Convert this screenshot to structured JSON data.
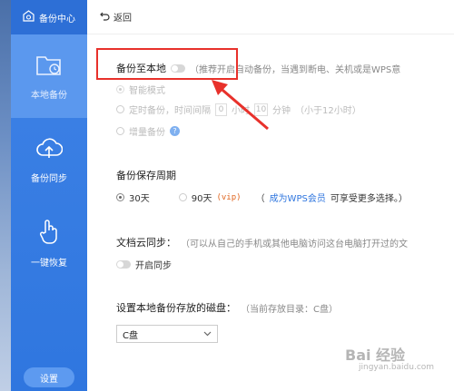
{
  "sidebar": {
    "header_label": "备份中心",
    "items": [
      {
        "label": "本地备份"
      },
      {
        "label": "备份同步"
      },
      {
        "label": "一键恢复"
      }
    ],
    "settings_label": "设置"
  },
  "topbar": {
    "back_label": "返回"
  },
  "local_backup": {
    "title": "备份至本地",
    "hint": "（推荐开启自动备份，当遇到断电、关机或是WPS意",
    "options": {
      "smart": "智能模式",
      "timed_prefix": "定时备份，时间间隔",
      "timed_hours_value": "0",
      "timed_hours_unit": "小时",
      "timed_minutes_value": "10",
      "timed_minutes_unit": "分钟",
      "timed_note": "（小于12小时）",
      "incremental": "增量备份"
    }
  },
  "retention": {
    "title": "备份保存周期",
    "opt_30": "30天",
    "opt_90": "90天",
    "vip_tag": "(vip)",
    "member_open": "（",
    "member_link": "成为WPS会员",
    "member_text": "可享受更多选择。）"
  },
  "cloud_sync": {
    "title": "文档云同步：",
    "hint": "（可以从自己的手机或其他电脑访问这台电脑打开过的文",
    "toggle_label": "开启同步"
  },
  "disk": {
    "title": "设置本地备份存放的磁盘：",
    "hint": "（当前存放目录：C盘）",
    "selected": "C盘"
  },
  "watermark": {
    "main": "Bai 经验",
    "sub": "jingyan.baidu.com"
  },
  "colors": {
    "sidebar_blue": "#2f76df",
    "link_blue": "#2f76df",
    "annotation_red": "#e8312b"
  }
}
